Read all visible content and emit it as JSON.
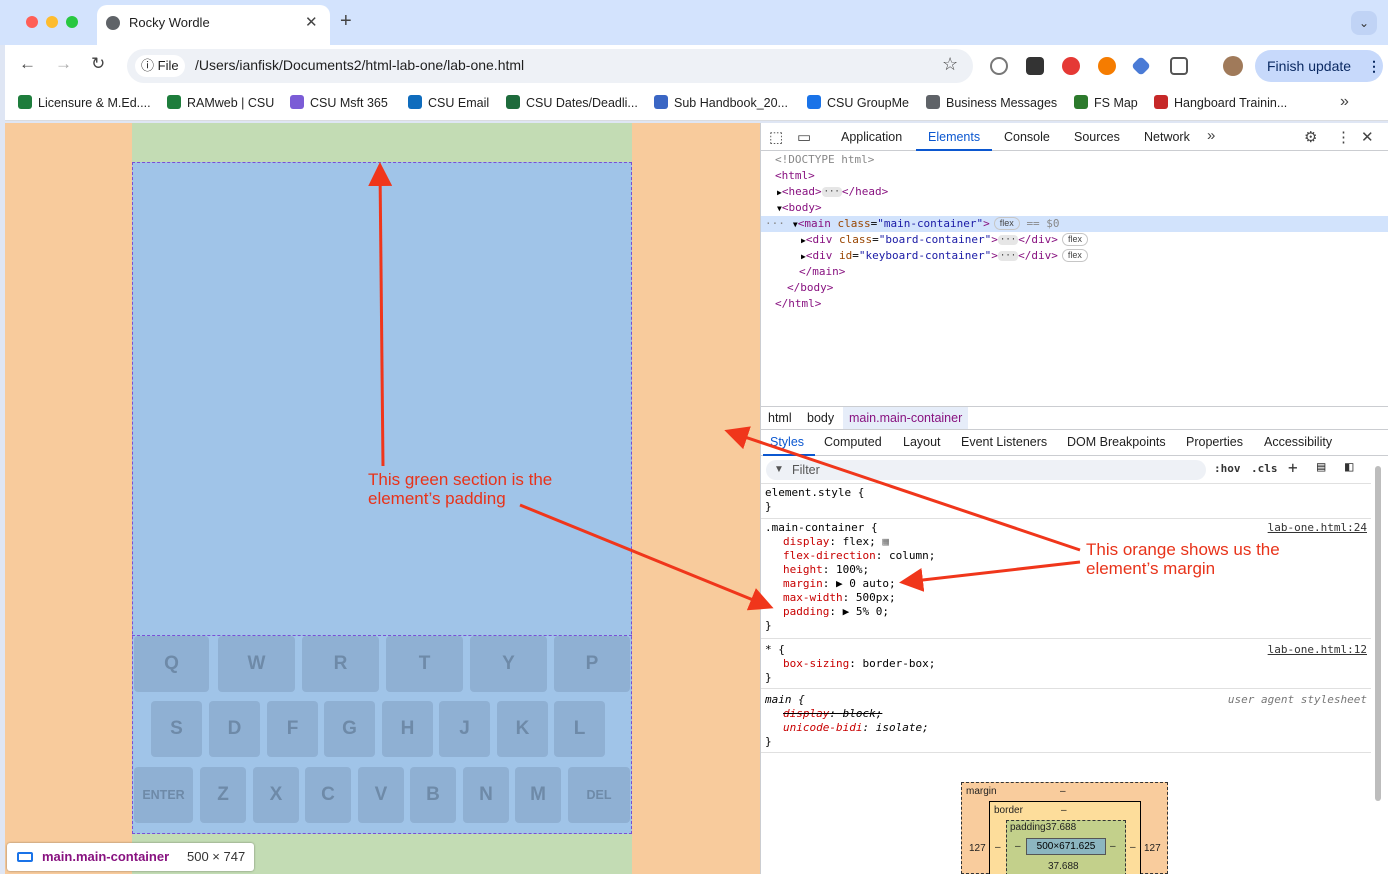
{
  "browser": {
    "tab_title": "Rocky Wordle",
    "tab_close": "✕",
    "new_tab": "+",
    "tab_menu": "⌄",
    "site_chip": "File",
    "url": "/Users/ianfisk/Documents2/html-lab-one/lab-one.html",
    "finish_update": "Finish update",
    "bookmarks": [
      {
        "label": "Licensure & M.Ed....",
        "color": "#1e7d3c"
      },
      {
        "label": "RAMweb | CSU",
        "color": "#1e7d3c"
      },
      {
        "label": "CSU Msft 365",
        "color": "#7b5cd6"
      },
      {
        "label": "CSU Email",
        "color": "#0f6cbd"
      },
      {
        "label": "CSU Dates/Deadli...",
        "color": "#1e6b3c"
      },
      {
        "label": "Sub Handbook_20...",
        "color": "#3a66c4"
      },
      {
        "label": "CSU GroupMe",
        "color": "#1a73e8"
      },
      {
        "label": "Business Messages",
        "color": "#5f6368"
      },
      {
        "label": "FS Map",
        "color": "#2c7a2c"
      },
      {
        "label": "Hangboard Trainin...",
        "color": "#c62828"
      }
    ]
  },
  "page": {
    "keyboard": {
      "row1": [
        "Q",
        "W",
        "R",
        "T",
        "Y",
        "P"
      ],
      "row2": [
        "S",
        "D",
        "F",
        "G",
        "H",
        "J",
        "K",
        "L"
      ],
      "row3": [
        "ENTER",
        "Z",
        "X",
        "C",
        "V",
        "B",
        "N",
        "M",
        "DEL"
      ]
    },
    "annotation_padding": [
      "This green section is the",
      "element’s padding"
    ],
    "annotation_margin": [
      "This orange shows us the",
      "element’s margin"
    ],
    "element_tip": {
      "selector": "main.main-container",
      "size": "500 × 747"
    },
    "annotation_color": "#e8331a"
  },
  "devtools": {
    "tabs": [
      "Application",
      "Elements",
      "Console",
      "Sources",
      "Network"
    ],
    "active_tab": "Elements",
    "dom": {
      "doctype": "<!DOCTYPE html>",
      "html_open": "<html>",
      "head": "<head>",
      "head_close": "</head>",
      "body_open": "<body>",
      "main_tag": "<main",
      "main_attr": "class",
      "main_val": "\"main-container\"",
      "main_end": ">",
      "main_pill": "flex",
      "main_suffix": "== $0",
      "child1_tag": "<div",
      "child1_attr": "class",
      "child1_val": "\"board-container\"",
      "child1_close": "</div>",
      "child2_tag": "<div",
      "child2_attr": "id",
      "child2_val": "\"keyboard-container\"",
      "child2_close": "</div>",
      "child_pill": "flex",
      "main_close": "</main>",
      "body_close": "</body>",
      "html_close": "</html>"
    },
    "breadcrumbs": [
      "html",
      "body",
      "main.main-container"
    ],
    "sub_tabs": [
      "Styles",
      "Computed",
      "Layout",
      "Event Listeners",
      "DOM Breakpoints",
      "Properties",
      "Accessibility"
    ],
    "filter_placeholder": "Filter",
    "filter_buttons": [
      ":hov",
      ".cls",
      "+"
    ],
    "styles": {
      "element_style": "element.style {",
      "close": "}",
      "rule1_selector": ".main-container {",
      "rule1_source": "lab-one.html:24",
      "rule1_props": [
        {
          "name": "display",
          "value": "flex;"
        },
        {
          "name": "flex-direction",
          "value": "column;"
        },
        {
          "name": "height",
          "value": "100%;"
        },
        {
          "name": "margin",
          "value": "▶ 0 auto;"
        },
        {
          "name": "max-width",
          "value": "500px;"
        },
        {
          "name": "padding",
          "value": "▶ 5% 0;"
        }
      ],
      "rule2_selector": "* {",
      "rule2_source": "lab-one.html:12",
      "rule2_prop": {
        "name": "box-sizing",
        "value": "border-box;"
      },
      "rule3_selector": "main {",
      "rule3_source": "user agent stylesheet",
      "rule3_props": [
        {
          "name": "display",
          "value": "block;"
        },
        {
          "name": "unicode-bidi",
          "value": "isolate;"
        }
      ]
    },
    "box_model": {
      "margin_label": "margin",
      "margin_top": "–",
      "margin_left": "127",
      "margin_right": "127",
      "border_label": "border",
      "border_top": "–",
      "border_left": "–",
      "border_right": "–",
      "padding_label": "padding37.688",
      "padding_left": "–",
      "padding_right": "–",
      "padding_bottom": "37.688",
      "content": "500×671.625"
    }
  }
}
